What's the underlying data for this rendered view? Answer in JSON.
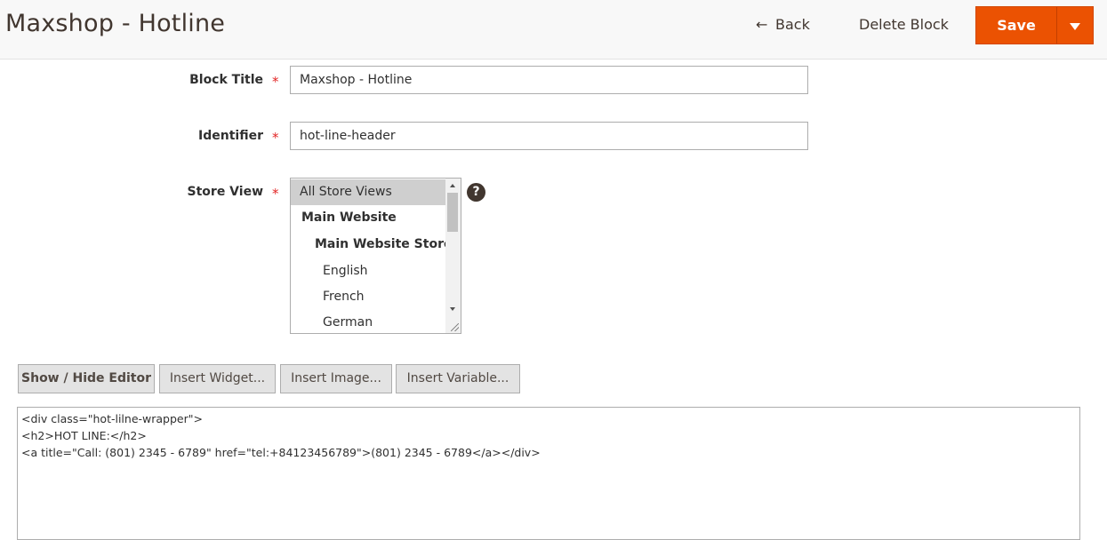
{
  "header": {
    "title": "Maxshop - Hotline",
    "back_label": "Back",
    "delete_label": "Delete Block",
    "save_label": "Save",
    "back_icon": "←",
    "help_icon": "?"
  },
  "form": {
    "block_title": {
      "label": "Block Title",
      "value": "Maxshop - Hotline",
      "required": "*"
    },
    "identifier": {
      "label": "Identifier",
      "value": "hot-line-header",
      "required": "*"
    },
    "store_view": {
      "label": "Store View",
      "required": "*",
      "options": [
        "All Store Views",
        "Main Website",
        "Main Website Store",
        "English",
        "French",
        "German"
      ],
      "selected": "All Store Views"
    }
  },
  "editor_buttons": [
    "Show / Hide Editor",
    "Insert Widget...",
    "Insert Image...",
    "Insert Variable..."
  ],
  "content_lines": [
    "<div class=\"hot-lilne-wrapper\">",
    "<h2>HOT LINE:</h2>",
    "<a title=\"Call: (801) 2345 - 6789\" href=\"tel:+84123456789\">(801) 2345 - 6789</a></div>"
  ],
  "colors": {
    "accent": "#eb5202",
    "required": "#e22626",
    "title": "#41362f"
  }
}
